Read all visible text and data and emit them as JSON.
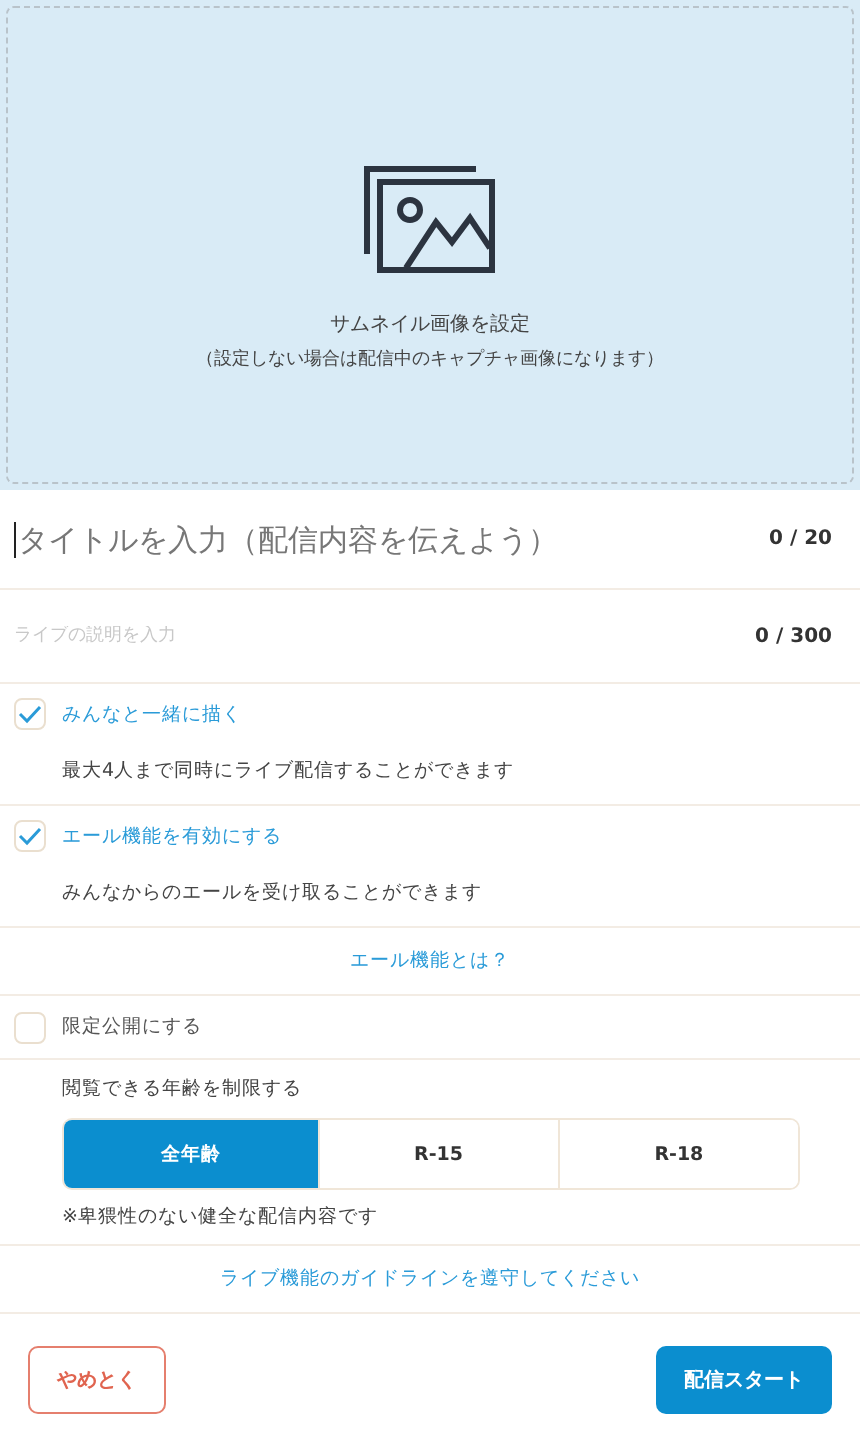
{
  "thumbnail": {
    "title": "サムネイル画像を設定",
    "note": "（設定しない場合は配信中のキャプチャ画像になります）"
  },
  "title_field": {
    "placeholder": "タイトルを入力（配信内容を伝えよう）",
    "counter": "0 / 20"
  },
  "description_field": {
    "placeholder": "ライブの説明を入力",
    "counter": "0 / 300"
  },
  "options": [
    {
      "label": "みんなと一緒に描く",
      "checked": true,
      "description": "最大4人まで同時にライブ配信することができます"
    },
    {
      "label": "エール機能を有効にする",
      "checked": true,
      "description": "みんなからのエールを受け取ることができます"
    }
  ],
  "cheer_link": "エール機能とは？",
  "private_option": {
    "label": "限定公開にする",
    "checked": false
  },
  "age_limit": {
    "label": "閲覧できる年齢を制限する",
    "choices": [
      {
        "label": "全年齢",
        "selected": true
      },
      {
        "label": "R-15",
        "selected": false
      },
      {
        "label": "R-18",
        "selected": false
      }
    ],
    "note": "※卑猥性のない健全な配信内容です"
  },
  "guideline_link": "ライブ機能のガイドラインを遵守してください",
  "buttons": {
    "cancel": "やめとく",
    "start": "配信スタート"
  }
}
